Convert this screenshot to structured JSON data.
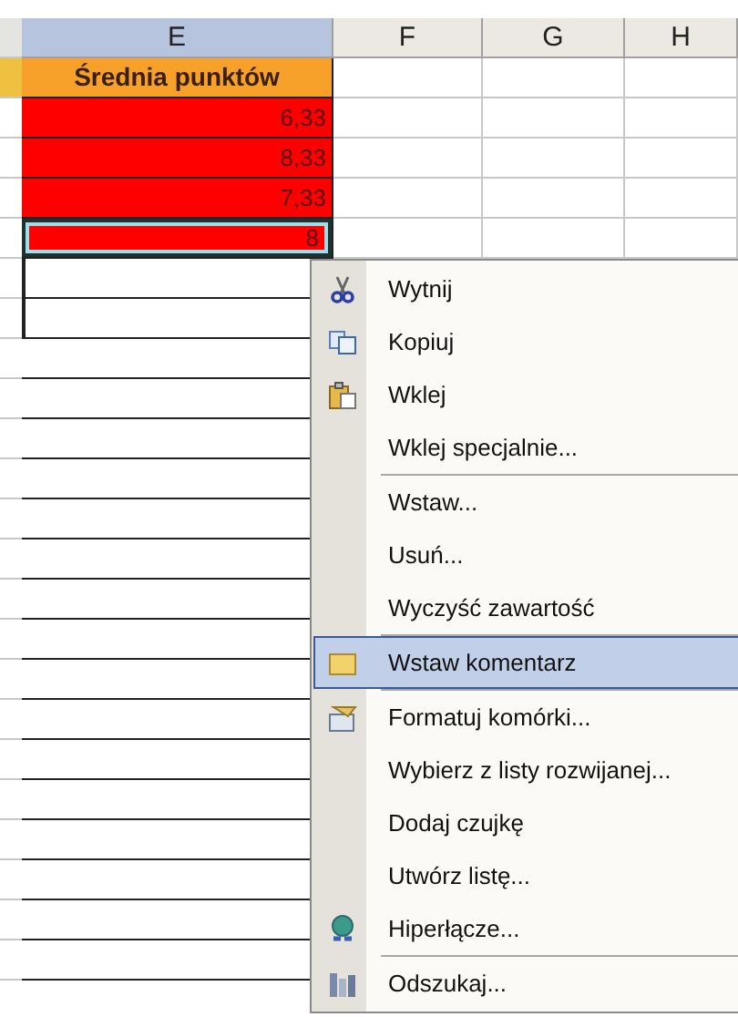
{
  "columns": [
    {
      "label": "E",
      "selected": true
    },
    {
      "label": "F",
      "selected": false
    },
    {
      "label": "G",
      "selected": false
    },
    {
      "label": "H",
      "selected": false
    }
  ],
  "cells": [
    {
      "value": "Średnia punktów",
      "kind": "header",
      "selected": false
    },
    {
      "value": "6,33",
      "kind": "alert",
      "selected": false
    },
    {
      "value": "8,33",
      "kind": "alert",
      "selected": false
    },
    {
      "value": "7,33",
      "kind": "alert",
      "selected": false
    },
    {
      "value": "8",
      "kind": "alert",
      "selected": true
    }
  ],
  "context_menu": {
    "items": [
      {
        "label": "Wytnij",
        "kind": "scissors",
        "separator_before": false,
        "selected": false
      },
      {
        "label": "Kopiuj",
        "kind": "copy",
        "separator_before": false,
        "selected": false
      },
      {
        "label": "Wklej",
        "kind": "paste",
        "separator_before": false,
        "selected": false
      },
      {
        "label": "Wklej specjalnie...",
        "kind": "text",
        "separator_before": false,
        "selected": false
      },
      {
        "label": "Wstaw...",
        "kind": "text",
        "separator_before": true,
        "selected": false
      },
      {
        "label": "Usuń...",
        "kind": "text",
        "separator_before": false,
        "selected": false
      },
      {
        "label": "Wyczyść zawartość",
        "kind": "text",
        "separator_before": false,
        "selected": false
      },
      {
        "label": "Wstaw komentarz",
        "kind": "comment",
        "separator_before": true,
        "selected": true
      },
      {
        "label": "Formatuj komórki...",
        "kind": "format",
        "separator_before": true,
        "selected": false
      },
      {
        "label": "Wybierz z listy rozwijanej...",
        "kind": "text",
        "separator_before": false,
        "selected": false
      },
      {
        "label": "Dodaj czujkę",
        "kind": "text",
        "separator_before": false,
        "selected": false
      },
      {
        "label": "Utwórz listę...",
        "kind": "text",
        "separator_before": false,
        "selected": false
      },
      {
        "label": "Hiperłącze...",
        "kind": "link",
        "separator_before": false,
        "selected": false
      },
      {
        "label": "Odszukaj...",
        "kind": "research",
        "separator_before": true,
        "selected": false
      }
    ]
  }
}
